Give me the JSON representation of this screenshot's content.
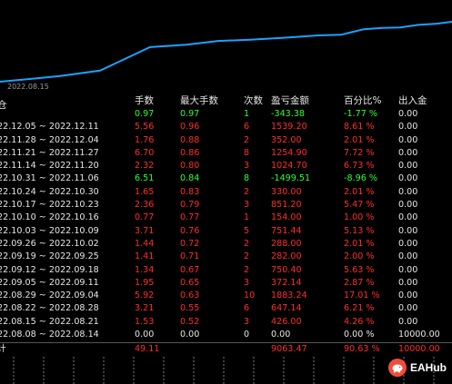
{
  "chart": {
    "date_label": "2022.08.15",
    "line_color": "#1aa3ff",
    "equity_curve": [
      0,
      0.04,
      0.09,
      0.18,
      0.56,
      0.6,
      0.66,
      0.68,
      0.71,
      0.75,
      0.76,
      0.85,
      0.87,
      0.88,
      0.92,
      0.94,
      0.97
    ]
  },
  "table": {
    "headers": {
      "period": "仓",
      "lots": "手数",
      "max_lots": "最大手数",
      "trades": "次数",
      "pnl": "盈亏金额",
      "pct": "百分比%",
      "io": "出入金"
    },
    "rows": [
      {
        "period": "",
        "lots": "0.97",
        "max_lots": "0.97",
        "trades": "1",
        "pnl": "-343.38",
        "pct": "-1.77 %",
        "io": "0.00",
        "color": "green"
      },
      {
        "period": "22.12.05 ~ 2022.12.11",
        "lots": "5.56",
        "max_lots": "0.96",
        "trades": "6",
        "pnl": "1539.20",
        "pct": "8.61 %",
        "io": "0.00",
        "color": "red"
      },
      {
        "period": "22.11.28 ~ 2022.12.04",
        "lots": "1.76",
        "max_lots": "0.88",
        "trades": "2",
        "pnl": "352.00",
        "pct": "2.01 %",
        "io": "0.00",
        "color": "red"
      },
      {
        "period": "22.11.21 ~ 2022.11.27",
        "lots": "6.70",
        "max_lots": "0.86",
        "trades": "8",
        "pnl": "1254.90",
        "pct": "7.72 %",
        "io": "0.00",
        "color": "red"
      },
      {
        "period": "22.11.14 ~ 2022.11.20",
        "lots": "2.32",
        "max_lots": "0.80",
        "trades": "3",
        "pnl": "1024.70",
        "pct": "6.73 %",
        "io": "0.00",
        "color": "red"
      },
      {
        "period": "22.10.31 ~ 2022.11.06",
        "lots": "6.51",
        "max_lots": "0.84",
        "trades": "8",
        "pnl": "-1499.51",
        "pct": "-8.96 %",
        "io": "0.00",
        "color": "green"
      },
      {
        "period": "22.10.24 ~ 2022.10.30",
        "lots": "1.65",
        "max_lots": "0.83",
        "trades": "2",
        "pnl": "330.00",
        "pct": "2.01 %",
        "io": "0.00",
        "color": "red"
      },
      {
        "period": "22.10.17 ~ 2022.10.23",
        "lots": "2.36",
        "max_lots": "0.79",
        "trades": "3",
        "pnl": "851.20",
        "pct": "5.47 %",
        "io": "0.00",
        "color": "red"
      },
      {
        "period": "22.10.10 ~ 2022.10.16",
        "lots": "0.77",
        "max_lots": "0.77",
        "trades": "1",
        "pnl": "154.00",
        "pct": "1.00 %",
        "io": "0.00",
        "color": "red"
      },
      {
        "period": "22.10.03 ~ 2022.10.09",
        "lots": "3.71",
        "max_lots": "0.76",
        "trades": "5",
        "pnl": "751.44",
        "pct": "5.13 %",
        "io": "0.00",
        "color": "red"
      },
      {
        "period": "22.09.26 ~ 2022.10.02",
        "lots": "1.44",
        "max_lots": "0.72",
        "trades": "2",
        "pnl": "288.00",
        "pct": "2.01 %",
        "io": "0.00",
        "color": "red"
      },
      {
        "period": "22.09.19 ~ 2022.09.25",
        "lots": "1.41",
        "max_lots": "0.71",
        "trades": "2",
        "pnl": "282.00",
        "pct": "2.00 %",
        "io": "0.00",
        "color": "red"
      },
      {
        "period": "22.09.12 ~ 2022.09.18",
        "lots": "1.34",
        "max_lots": "0.67",
        "trades": "2",
        "pnl": "750.40",
        "pct": "5.63 %",
        "io": "0.00",
        "color": "red"
      },
      {
        "period": "22.09.05 ~ 2022.09.11",
        "lots": "1.95",
        "max_lots": "0.65",
        "trades": "3",
        "pnl": "372.14",
        "pct": "2.87 %",
        "io": "0.00",
        "color": "red"
      },
      {
        "period": "22.08.29 ~ 2022.09.04",
        "lots": "5.92",
        "max_lots": "0.63",
        "trades": "10",
        "pnl": "1883.24",
        "pct": "17.01 %",
        "io": "0.00",
        "color": "red"
      },
      {
        "period": "22.08.22 ~ 2022.08.28",
        "lots": "3.21",
        "max_lots": "0.55",
        "trades": "6",
        "pnl": "647.14",
        "pct": "6.21 %",
        "io": "0.00",
        "color": "red"
      },
      {
        "period": "22.08.15 ~ 2022.08.21",
        "lots": "1.53",
        "max_lots": "0.52",
        "trades": "3",
        "pnl": "426.00",
        "pct": "4.26 %",
        "io": "0.00",
        "color": "red"
      },
      {
        "period": "22.08.08 ~ 2022.08.14",
        "lots": "0.00",
        "max_lots": "0.00",
        "trades": "0",
        "pnl": "0.00",
        "pct": "0.00 %",
        "io": "10000.00",
        "color": "white"
      }
    ],
    "total": {
      "period": "计",
      "lots": "49.11",
      "max_lots": "",
      "trades": "",
      "pnl": "9063.47",
      "pct": "90.63 %",
      "io": "10000.00",
      "color": "red"
    }
  },
  "brand": {
    "logo_text": "EAHub",
    "logo_icon": "piggy-icon",
    "logo_color": "#f04e3a"
  }
}
